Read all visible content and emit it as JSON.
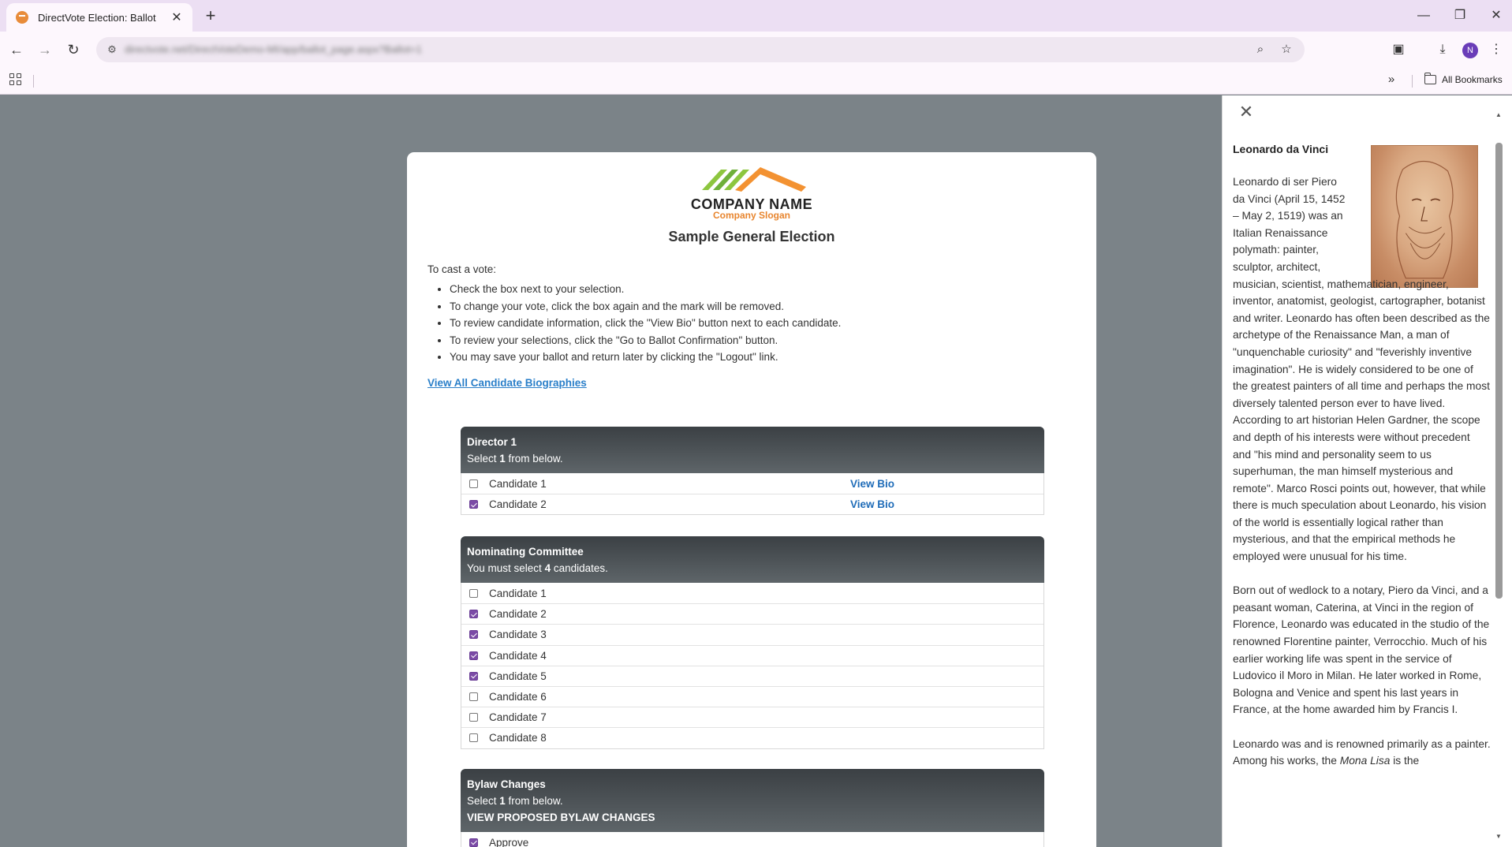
{
  "browser": {
    "tab_title": "DirectVote Election: Ballot",
    "url": "directvote.net/DirectVoteDemo-MI/app/ballot_page.aspx?Ballot=1",
    "profile_initial": "N",
    "all_bookmarks": "All Bookmarks"
  },
  "brand": {
    "company_name": "COMPANY NAME",
    "slogan": "Company Slogan",
    "logo_colors": [
      "#8dc63f",
      "#6fb03a",
      "#f39232"
    ]
  },
  "ballot": {
    "title": "Sample General Election",
    "intro": "To cast a vote:",
    "instructions": [
      "Check the box next to your selection.",
      "To change your vote, click the box again and the mark will be removed.",
      "To review candidate information, click the \"View Bio\" button next to each candidate.",
      "To review your selections, click the \"Go to Ballot Confirmation\" button.",
      "You may save your ballot and return later by clicking the \"Logout\" link."
    ],
    "bios_link": "View All Candidate Biographies",
    "view_bio_label": "View Bio",
    "contests": [
      {
        "title": "Director 1",
        "instruction_prefix": "Select ",
        "instruction_count": "1",
        "instruction_suffix": " from below.",
        "candidates": [
          {
            "name": "Candidate 1",
            "checked": false
          },
          {
            "name": "Candidate 2",
            "checked": true
          }
        ]
      },
      {
        "title": "Nominating Committee",
        "instruction_prefix": "You must select ",
        "instruction_count": "4",
        "instruction_suffix": " candidates.",
        "candidates": [
          {
            "name": "Candidate 1",
            "checked": false
          },
          {
            "name": "Candidate 2",
            "checked": true
          },
          {
            "name": "Candidate 3",
            "checked": true
          },
          {
            "name": "Candidate 4",
            "checked": true
          },
          {
            "name": "Candidate 5",
            "checked": true
          },
          {
            "name": "Candidate 6",
            "checked": false
          },
          {
            "name": "Candidate 7",
            "checked": false
          },
          {
            "name": "Candidate 8",
            "checked": false
          }
        ]
      },
      {
        "title": "Bylaw Changes",
        "instruction_prefix": "Select ",
        "instruction_count": "1",
        "instruction_suffix": " from below.",
        "extra_line": "VIEW PROPOSED BYLAW CHANGES",
        "options": [
          {
            "name": "Approve",
            "checked": true
          }
        ]
      }
    ]
  },
  "bio_panel": {
    "name": "Leonardo da Vinci",
    "paragraphs": [
      "Leonardo di ser Piero da Vinci (April 15, 1452 – May 2, 1519) was an Italian Renaissance polymath: painter, sculptor, architect, musician, scientist, mathematician, engineer, inventor, anatomist, geologist, cartographer, botanist and writer. Leonardo has often been described as the archetype of the Renaissance Man, a man of \"unquenchable curiosity\" and \"feverishly inventive imagination\". He is widely considered to be one of the greatest painters of all time and perhaps the most diversely talented person ever to have lived. According to art historian Helen Gardner, the scope and depth of his interests were without precedent and \"his mind and personality seem to us superhuman, the man himself mysterious and remote\". Marco Rosci points out, however, that while there is much speculation about Leonardo, his vision of the world is essentially logical rather than mysterious, and that the empirical methods he employed were unusual for his time.",
      "Born out of wedlock to a notary, Piero da Vinci, and a peasant woman, Caterina, at Vinci in the region of Florence, Leonardo was educated in the studio of the renowned Florentine painter, Verrocchio. Much of his earlier working life was spent in the service of Ludovico il Moro in Milan. He later worked in Rome, Bologna and Venice and spent his last years in France, at the home awarded him by Francis I."
    ],
    "paragraph3_prefix": "Leonardo was and is renowned primarily as a painter. Among his works, the ",
    "paragraph3_italic": "Mona Lisa",
    "paragraph3_suffix": " is the"
  }
}
